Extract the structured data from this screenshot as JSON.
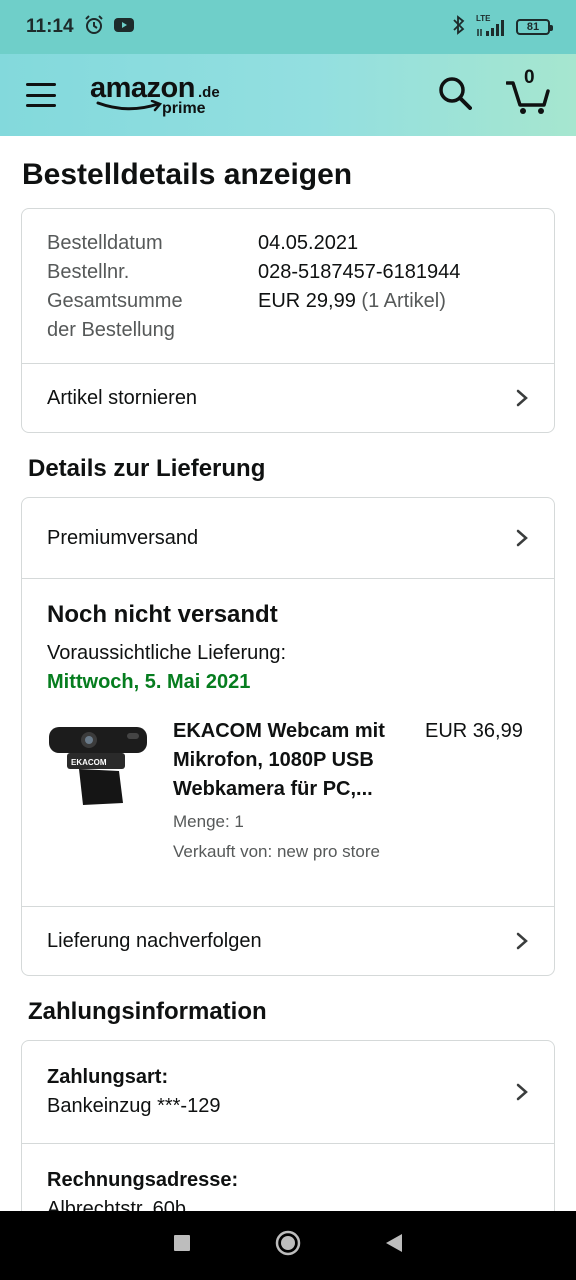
{
  "status_bar": {
    "time": "11:14",
    "network": "LTE",
    "battery": "81"
  },
  "app_header": {
    "logo_word": "amazon",
    "logo_tld": ".de",
    "logo_sub": "prime",
    "cart_count": "0"
  },
  "page_title": "Bestelldetails anzeigen",
  "order_summary": {
    "date_label": "Bestelldatum",
    "date_value": "04.05.2021",
    "number_label": "Bestellnr.",
    "number_value": "028-5187457-6181944",
    "total_label": "Gesamtsumme der Bestellung",
    "total_value": "EUR 29,99",
    "total_count": "(1 Artikel)",
    "cancel_label": "Artikel stornieren"
  },
  "delivery": {
    "heading": "Details zur Lieferung",
    "shipping_method": "Premiumversand",
    "status": "Noch nicht versandt",
    "expected_label": "Voraussichtliche Lieferung:",
    "expected_date": "Mittwoch, 5. Mai 2021",
    "item": {
      "name": "EKACOM Webcam mit Mikrofon, 1080P USB Webkamera für PC,...",
      "price": "EUR 36,99",
      "quantity": "Menge: 1",
      "seller": "Verkauft von: new pro store",
      "image_brand": "EKACOM"
    },
    "track_label": "Lieferung nachverfolgen"
  },
  "payment": {
    "heading": "Zahlungsinformation",
    "method_label": "Zahlungsart:",
    "method_value": "Bankeinzug ***-129",
    "billing_label": "Rechnungsadresse:",
    "billing_value": "Albrechtstr. 60b"
  },
  "colors": {
    "status_bar": "#6fcfc9",
    "header_gradient_start": "#83d9dc",
    "header_gradient_end": "#a6e6cf",
    "delivery_date_green": "#067d1f",
    "border": "#d5d9d9",
    "muted_text": "#565959"
  },
  "icons": {
    "menu": "hamburger-icon",
    "search": "search-icon",
    "cart": "cart-icon",
    "chevron": "chevron-right-icon",
    "nav_back": "back-triangle-icon",
    "nav_home": "home-circle-icon",
    "nav_recents": "recents-square-icon"
  }
}
